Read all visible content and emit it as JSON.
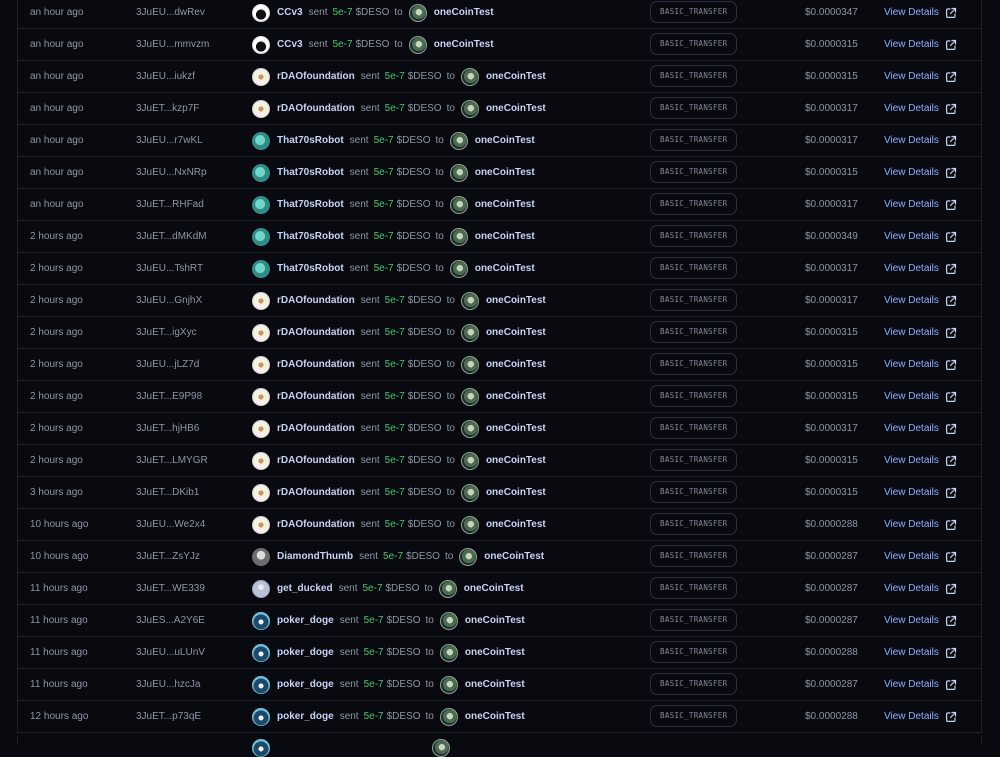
{
  "common": {
    "sent": "sent",
    "to": "to",
    "amount": "5e-7",
    "unit": "$DESO",
    "recipient": "oneCoinTest",
    "type": "BASIC_TRANSFER",
    "link": "View Details",
    "icons": {
      "external": "external-link-icon"
    }
  },
  "rows": [
    {
      "time": "an hour ago",
      "hash": "3JuEU...dwRev",
      "sender": "CCv3",
      "avatar": "ccv3",
      "usd": "$0.0000347"
    },
    {
      "time": "an hour ago",
      "hash": "3JuEU...mmvzm",
      "sender": "CCv3",
      "avatar": "ccv3",
      "usd": "$0.0000315"
    },
    {
      "time": "an hour ago",
      "hash": "3JuEU...iukzf",
      "sender": "rDAOfoundation",
      "avatar": "rdao",
      "usd": "$0.0000315"
    },
    {
      "time": "an hour ago",
      "hash": "3JuET...kzp7F",
      "sender": "rDAOfoundation",
      "avatar": "rdao",
      "usd": "$0.0000317"
    },
    {
      "time": "an hour ago",
      "hash": "3JuEU...r7wKL",
      "sender": "That70sRobot",
      "avatar": "robot",
      "usd": "$0.0000317"
    },
    {
      "time": "an hour ago",
      "hash": "3JuEU...NxNRp",
      "sender": "That70sRobot",
      "avatar": "robot",
      "usd": "$0.0000315"
    },
    {
      "time": "an hour ago",
      "hash": "3JuET...RHFad",
      "sender": "That70sRobot",
      "avatar": "robot",
      "usd": "$0.0000317"
    },
    {
      "time": "2 hours ago",
      "hash": "3JuET...dMKdM",
      "sender": "That70sRobot",
      "avatar": "robot",
      "usd": "$0.0000349"
    },
    {
      "time": "2 hours ago",
      "hash": "3JuEU...TshRT",
      "sender": "That70sRobot",
      "avatar": "robot",
      "usd": "$0.0000317"
    },
    {
      "time": "2 hours ago",
      "hash": "3JuEU...GnjhX",
      "sender": "rDAOfoundation",
      "avatar": "rdao",
      "usd": "$0.0000317"
    },
    {
      "time": "2 hours ago",
      "hash": "3JuET...igXyc",
      "sender": "rDAOfoundation",
      "avatar": "rdao",
      "usd": "$0.0000315"
    },
    {
      "time": "2 hours ago",
      "hash": "3JuEU...jLZ7d",
      "sender": "rDAOfoundation",
      "avatar": "rdao",
      "usd": "$0.0000315"
    },
    {
      "time": "2 hours ago",
      "hash": "3JuET...E9P98",
      "sender": "rDAOfoundation",
      "avatar": "rdao",
      "usd": "$0.0000315"
    },
    {
      "time": "2 hours ago",
      "hash": "3JuET...hjHB6",
      "sender": "rDAOfoundation",
      "avatar": "rdao",
      "usd": "$0.0000317"
    },
    {
      "time": "2 hours ago",
      "hash": "3JuET...LMYGR",
      "sender": "rDAOfoundation",
      "avatar": "rdao",
      "usd": "$0.0000315"
    },
    {
      "time": "3 hours ago",
      "hash": "3JuET...DKib1",
      "sender": "rDAOfoundation",
      "avatar": "rdao",
      "usd": "$0.0000315"
    },
    {
      "time": "10 hours ago",
      "hash": "3JuEU...We2x4",
      "sender": "rDAOfoundation",
      "avatar": "rdao",
      "usd": "$0.0000288"
    },
    {
      "time": "10 hours ago",
      "hash": "3JuET...ZsYJz",
      "sender": "DiamondThumb",
      "avatar": "diamond",
      "usd": "$0.0000287"
    },
    {
      "time": "11 hours ago",
      "hash": "3JuET...WE339",
      "sender": "get_ducked",
      "avatar": "ducked",
      "usd": "$0.0000287"
    },
    {
      "time": "11 hours ago",
      "hash": "3JuES...A2Y6E",
      "sender": "poker_doge",
      "avatar": "poker",
      "usd": "$0.0000287"
    },
    {
      "time": "11 hours ago",
      "hash": "3JuEU...uLUnV",
      "sender": "poker_doge",
      "avatar": "poker",
      "usd": "$0.0000288"
    },
    {
      "time": "11 hours ago",
      "hash": "3JuEU...hzcJa",
      "sender": "poker_doge",
      "avatar": "poker",
      "usd": "$0.0000287"
    },
    {
      "time": "12 hours ago",
      "hash": "3JuET...p73qE",
      "sender": "poker_doge",
      "avatar": "poker",
      "usd": "$0.0000288"
    }
  ]
}
